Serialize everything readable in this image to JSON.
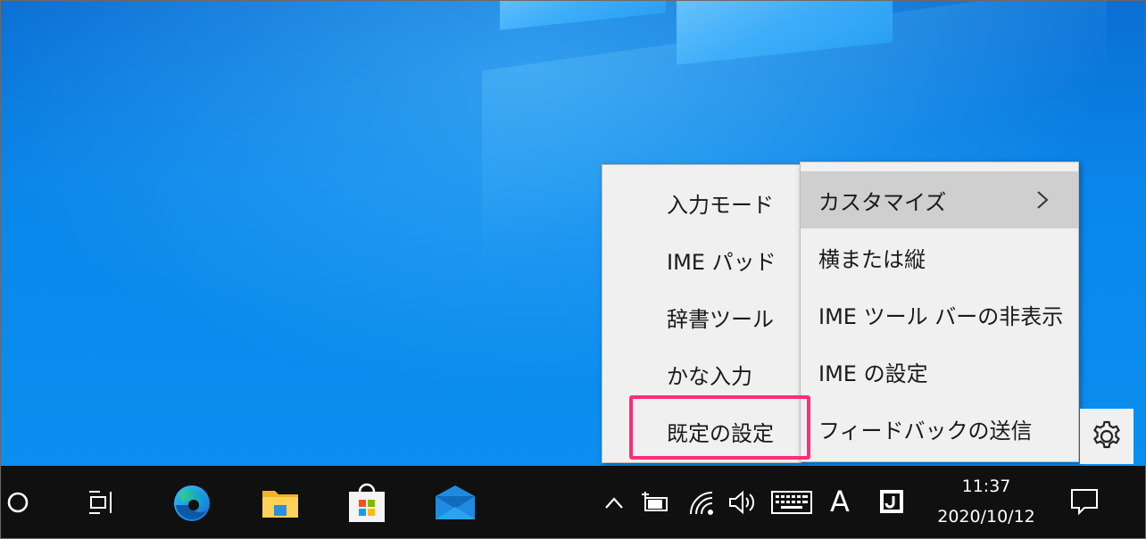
{
  "ime_context_menu": {
    "left_items": [
      {
        "label": "入力モード"
      },
      {
        "label": "IME パッド"
      },
      {
        "label": "辞書ツール"
      },
      {
        "label": "かな入力"
      },
      {
        "label": "既定の設定"
      }
    ],
    "right_items": [
      {
        "label": "カスタマイズ",
        "has_submenu": true,
        "hovered": true
      },
      {
        "label": "横または縦"
      },
      {
        "label": "IME ツール バーの非表示"
      },
      {
        "label": "IME の設定"
      },
      {
        "label": "フィードバックの送信"
      }
    ],
    "highlighted_item": "既定の設定",
    "highlight_color": "#ff2d7a"
  },
  "ime_toolbar": {
    "settings_icon": "gear-icon"
  },
  "taskbar": {
    "left_icons": [
      "cortana-circle-icon",
      "task-view-icon",
      "edge-icon",
      "file-explorer-icon",
      "microsoft-store-icon",
      "mail-icon"
    ],
    "tray": {
      "icons": [
        "chevron-up-icon",
        "battery-icon",
        "wifi-icon",
        "volume-icon",
        "touch-keyboard-icon",
        "ime-mode-icon",
        "ime-toolbar-icon"
      ],
      "ime_mode_label": "A",
      "time": "11:37",
      "date": "2020/10/12"
    },
    "notification_icon": "action-center-icon"
  },
  "colors": {
    "desktop_blue": "#0a86ea",
    "taskbar": "#101010",
    "menu_bg": "#f0f0f0",
    "menu_hover": "#cfcfcf"
  }
}
